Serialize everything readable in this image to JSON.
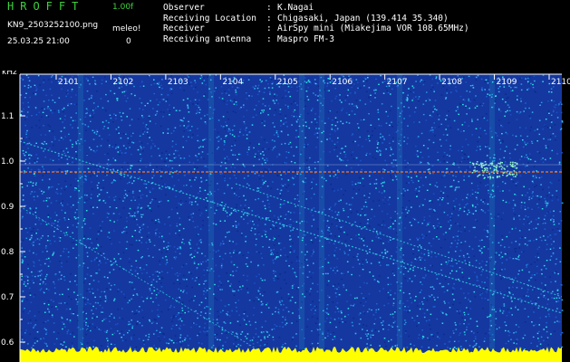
{
  "header": {
    "title": "HROFFT",
    "version": "1.00f",
    "filename": "KN9_2503252100.png",
    "timestamp": "25.03.25 21:00",
    "meleo_label": "meleo!",
    "meleo_count": "0",
    "info": [
      {
        "key": "Observer",
        "value": "K.Nagai"
      },
      {
        "key": "Receiving Location",
        "value": "Chigasaki, Japan (139.414 35.340)"
      },
      {
        "key": "Receiver",
        "value": "AirSpy mini (Miakejima VOR 108.65MHz)"
      },
      {
        "key": "Receiving antenna",
        "value": "Maspro FM-3"
      }
    ]
  },
  "spectrogram": {
    "unit_label": "kHz",
    "time_labels": [
      "2101",
      "2102",
      "2103",
      "2104",
      "2105",
      "2106",
      "2107",
      "2108",
      "2109",
      "2110"
    ],
    "freq_labels": [
      "1.1",
      "1.0",
      "0.9",
      "0.8",
      "0.7",
      "0.6"
    ],
    "colors": {
      "background": "#1438a0",
      "noise_high": "#2ee6e6",
      "carrier": "#ff7820",
      "baseline": "#ffff00",
      "axis": "#ffffff"
    }
  }
}
